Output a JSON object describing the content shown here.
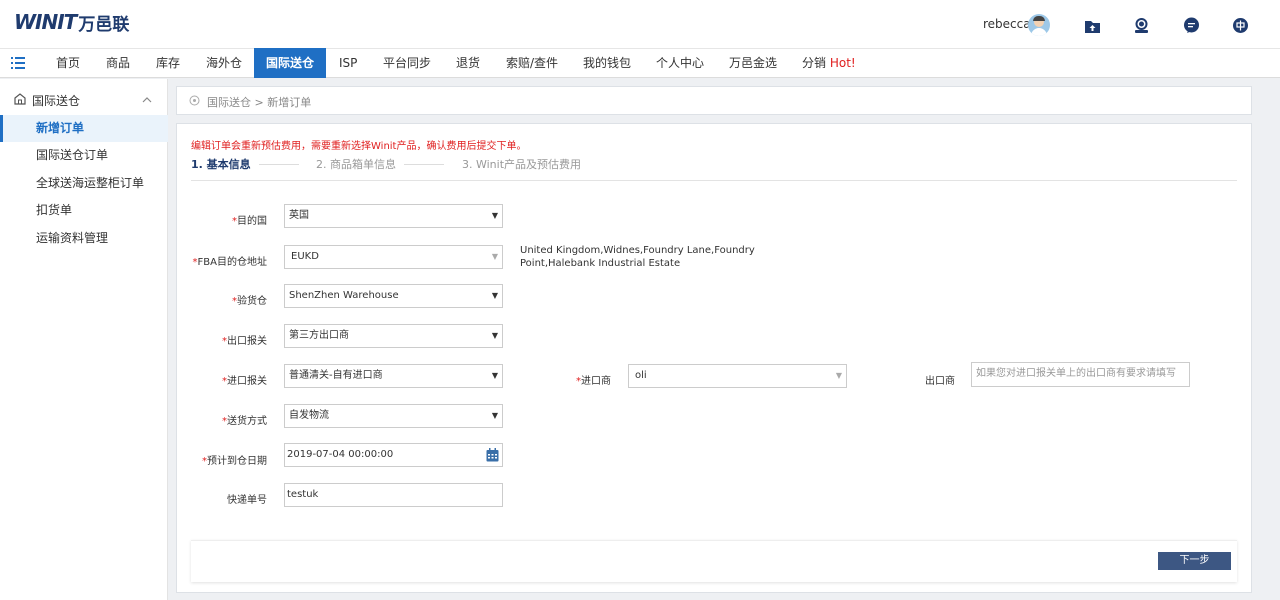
{
  "header": {
    "logo_text": "WINIT",
    "logo_cn": "万邑联",
    "username": "rebecca"
  },
  "nav": {
    "items": [
      {
        "label": "首页"
      },
      {
        "label": "商品"
      },
      {
        "label": "库存"
      },
      {
        "label": "海外仓"
      },
      {
        "label": "国际送仓",
        "active": true
      },
      {
        "label": "ISP"
      },
      {
        "label": "平台同步"
      },
      {
        "label": "退货"
      },
      {
        "label": "索赔/查件"
      },
      {
        "label": "我的钱包"
      },
      {
        "label": "个人中心"
      },
      {
        "label": "万邑金选"
      },
      {
        "label": "分销",
        "badge": "Hot!"
      }
    ]
  },
  "sidebar": {
    "section": "国际送仓",
    "items": [
      {
        "label": "新增订单",
        "active": true
      },
      {
        "label": "国际送仓订单"
      },
      {
        "label": "全球送海运整柜订单"
      },
      {
        "label": "扣货单"
      },
      {
        "label": "运输资料管理"
      }
    ]
  },
  "breadcrumb": "国际送仓 > 新增订单",
  "form": {
    "warning": "编辑订单会重新预估费用，需要重新选择Winit产品，确认费用后提交下单。",
    "steps": [
      "1. 基本信息",
      "2. 商品箱单信息",
      "3. Winit产品及预估费用"
    ],
    "destination_country": {
      "label": "目的国",
      "value": "英国"
    },
    "fba_address": {
      "label": "FBA目的仓地址",
      "value": "EUKD",
      "address_text": "United Kingdom,Widnes,Foundry Lane,Foundry Point,Halebank Industrial Estate"
    },
    "inspection_warehouse": {
      "label": "验货仓",
      "value": "ShenZhen Warehouse"
    },
    "export_declaration": {
      "label": "出口报关",
      "value": "第三方出口商"
    },
    "import_declaration": {
      "label": "进口报关",
      "value": "普通清关-自有进口商"
    },
    "importer": {
      "label": "进口商",
      "value": "oli"
    },
    "exporter": {
      "label": "出口商",
      "placeholder": "如果您对进口报关单上的出口商有要求请填写"
    },
    "delivery_method": {
      "label": "送货方式",
      "value": "自发物流"
    },
    "arrival_date": {
      "label": "预计到仓日期",
      "value": "2019-07-04 00:00:00"
    },
    "tracking_no": {
      "label": "快递单号",
      "value": "testuk"
    }
  },
  "buttons": {
    "next": "下一步"
  },
  "colors": {
    "primary": "#1f6fc4",
    "brand_dark": "#1f3b6e",
    "required": "#e02020",
    "button": "#3d5783"
  }
}
